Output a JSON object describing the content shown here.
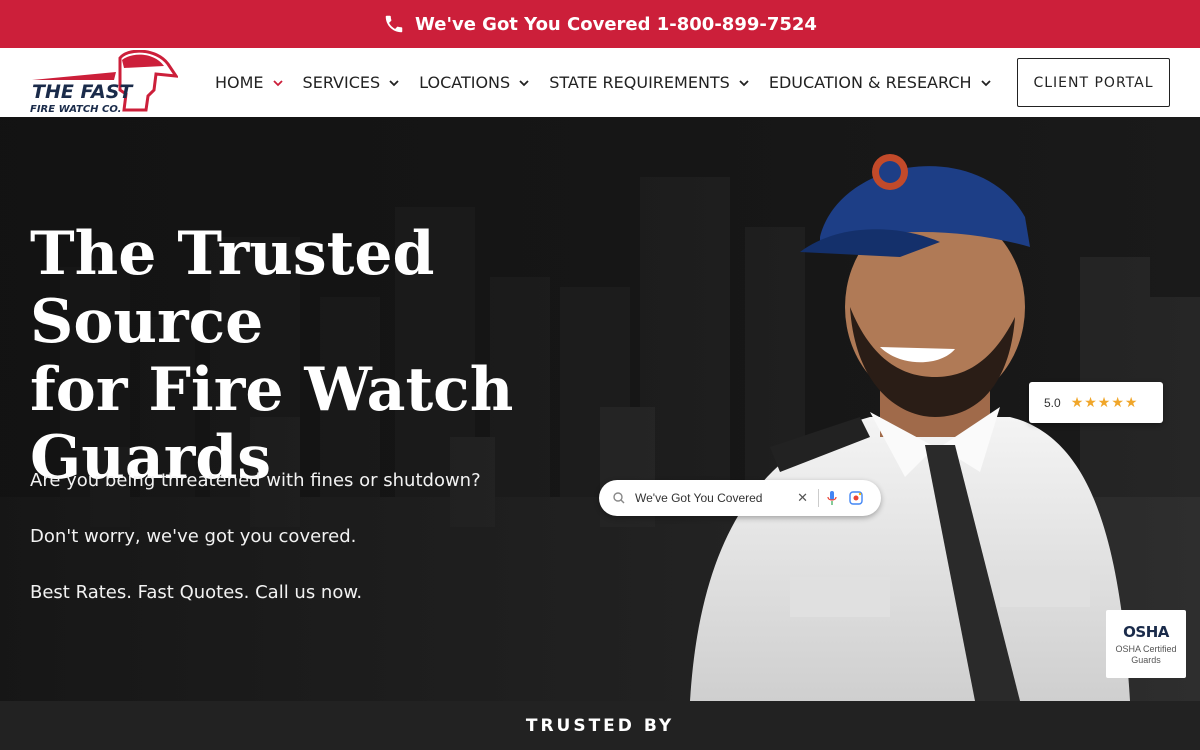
{
  "topbar": {
    "phone_text": "We've Got You Covered 1-800-899-7524",
    "background": "#cc1f3a"
  },
  "logo": {
    "line1": "THE FAST",
    "line2": "FIRE WATCH CO."
  },
  "nav": {
    "items": [
      {
        "label": "HOME",
        "active": true
      },
      {
        "label": "SERVICES"
      },
      {
        "label": "LOCATIONS"
      },
      {
        "label": "STATE REQUIREMENTS"
      },
      {
        "label": "EDUCATION & RESEARCH"
      }
    ],
    "portal_label": "CLIENT PORTAL"
  },
  "hero": {
    "headline_line1": "The Trusted Source",
    "headline_line2": "for Fire Watch",
    "headline_line3": "Guards",
    "sub1": "Are you being threatened with fines or shutdown?",
    "sub2": "Don't worry, we've got you covered.",
    "sub3": "Best Rates. Fast Quotes. Call us now.",
    "rating_value": "5.0",
    "rating_stars": "★★★★★",
    "search_query": "We've Got You Covered",
    "osha_logo": "OSHA",
    "osha_caption": "OSHA Certified Guards"
  },
  "trusted": {
    "label": "TRUSTED BY"
  },
  "colors": {
    "accent_red": "#cc1f3a",
    "star": "#f0a62a",
    "hero_bg": "#151515"
  }
}
